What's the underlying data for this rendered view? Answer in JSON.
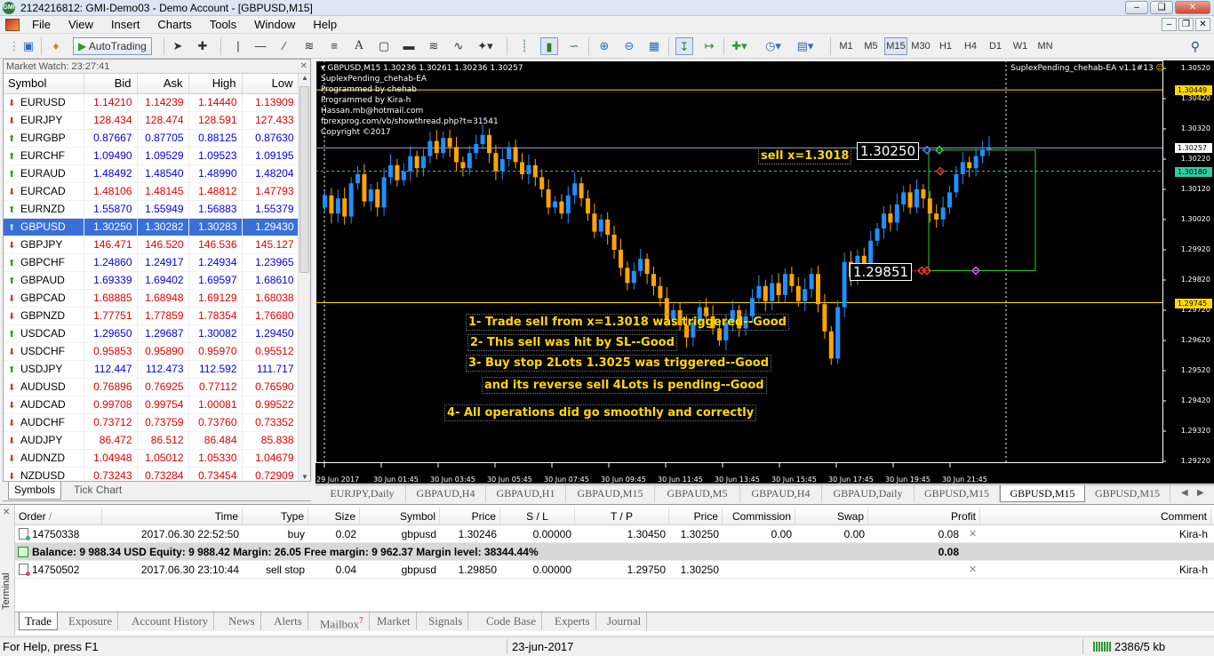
{
  "window": {
    "title": "2124216812: GMI-Demo03 - Demo Account - [GBPUSD,M15]",
    "app_icon_label": "GMI"
  },
  "menu": [
    "File",
    "View",
    "Insert",
    "Charts",
    "Tools",
    "Window",
    "Help"
  ],
  "toolbar": {
    "autotrading_label": "AutoTrading",
    "timeframes": [
      "M1",
      "M5",
      "M15",
      "M30",
      "H1",
      "H4",
      "D1",
      "W1",
      "MN"
    ],
    "active_timeframe": "M15"
  },
  "market_watch": {
    "title": "Market Watch: 23:27:41",
    "columns": [
      "Symbol",
      "Bid",
      "Ask",
      "High",
      "Low"
    ],
    "selected": "GBPUSD",
    "rows": [
      {
        "symbol": "EURUSD",
        "bid": "1.14210",
        "ask": "1.14239",
        "high": "1.14440",
        "low": "1.13909",
        "dir": "down"
      },
      {
        "symbol": "EURJPY",
        "bid": "128.434",
        "ask": "128.474",
        "high": "128.591",
        "low": "127.433",
        "dir": "down"
      },
      {
        "symbol": "EURGBP",
        "bid": "0.87667",
        "ask": "0.87705",
        "high": "0.88125",
        "low": "0.87630",
        "dir": "up"
      },
      {
        "symbol": "EURCHF",
        "bid": "1.09490",
        "ask": "1.09529",
        "high": "1.09523",
        "low": "1.09195",
        "dir": "up"
      },
      {
        "symbol": "EURAUD",
        "bid": "1.48492",
        "ask": "1.48540",
        "high": "1.48990",
        "low": "1.48204",
        "dir": "up"
      },
      {
        "symbol": "EURCAD",
        "bid": "1.48106",
        "ask": "1.48145",
        "high": "1.48812",
        "low": "1.47793",
        "dir": "down"
      },
      {
        "symbol": "EURNZD",
        "bid": "1.55870",
        "ask": "1.55949",
        "high": "1.56883",
        "low": "1.55379",
        "dir": "up"
      },
      {
        "symbol": "GBPUSD",
        "bid": "1.30250",
        "ask": "1.30282",
        "high": "1.30283",
        "low": "1.29430",
        "dir": "up"
      },
      {
        "symbol": "GBPJPY",
        "bid": "146.471",
        "ask": "146.520",
        "high": "146.536",
        "low": "145.127",
        "dir": "down"
      },
      {
        "symbol": "GBPCHF",
        "bid": "1.24860",
        "ask": "1.24917",
        "high": "1.24934",
        "low": "1.23965",
        "dir": "up"
      },
      {
        "symbol": "GBPAUD",
        "bid": "1.69339",
        "ask": "1.69402",
        "high": "1.69597",
        "low": "1.68610",
        "dir": "up"
      },
      {
        "symbol": "GBPCAD",
        "bid": "1.68885",
        "ask": "1.68948",
        "high": "1.69129",
        "low": "1.68038",
        "dir": "down"
      },
      {
        "symbol": "GBPNZD",
        "bid": "1.77751",
        "ask": "1.77859",
        "high": "1.78354",
        "low": "1.76680",
        "dir": "down"
      },
      {
        "symbol": "USDCAD",
        "bid": "1.29650",
        "ask": "1.29687",
        "high": "1.30082",
        "low": "1.29450",
        "dir": "up"
      },
      {
        "symbol": "USDCHF",
        "bid": "0.95853",
        "ask": "0.95890",
        "high": "0.95970",
        "low": "0.95512",
        "dir": "down"
      },
      {
        "symbol": "USDJPY",
        "bid": "112.447",
        "ask": "112.473",
        "high": "112.592",
        "low": "111.717",
        "dir": "up"
      },
      {
        "symbol": "AUDUSD",
        "bid": "0.76896",
        "ask": "0.76925",
        "high": "0.77112",
        "low": "0.76590",
        "dir": "down"
      },
      {
        "symbol": "AUDCAD",
        "bid": "0.99708",
        "ask": "0.99754",
        "high": "1.00081",
        "low": "0.99522",
        "dir": "down"
      },
      {
        "symbol": "AUDCHF",
        "bid": "0.73712",
        "ask": "0.73759",
        "high": "0.73760",
        "low": "0.73352",
        "dir": "down"
      },
      {
        "symbol": "AUDJPY",
        "bid": "86.472",
        "ask": "86.512",
        "high": "86.484",
        "low": "85.838",
        "dir": "down"
      },
      {
        "symbol": "AUDNZD",
        "bid": "1.04948",
        "ask": "1.05012",
        "high": "1.05330",
        "low": "1.04679",
        "dir": "down"
      },
      {
        "symbol": "NZDUSD",
        "bid": "0.73243",
        "ask": "0.73284",
        "high": "0.73454",
        "low": "0.72909",
        "dir": "down"
      }
    ],
    "tabs": [
      "Symbols",
      "Tick Chart"
    ],
    "active_tab": "Symbols"
  },
  "chart": {
    "header": "GBPUSD,M15  1.30236 1.30261 1.30236 1.30257",
    "ea_info": [
      "SuplexPending_chehab-EA",
      "Programmed by chehab",
      "Programmed by Kira-h",
      "Hassan.mb@hotmail.com",
      "forexprog.com/vb/showthread.php?t=31541",
      "Copyright ©2017"
    ],
    "ea_name": "SuplexPending_chehab-EA v1.1#13",
    "sell_label": "sell x=1.3018",
    "box_upper_label": "1.30250",
    "box_lower_label": "1.29851",
    "notes": [
      "1- Trade sell from x=1.3018 was triggered--Good",
      "2- This sell was hit by SL--Good",
      "3- Buy stop 2Lots 1.3025 was triggered--Good",
      "and its reverse sell 4Lots is pending--Good",
      "4- All operations did go smoothly and correctly"
    ],
    "price_labels": [
      "1.30520",
      "1.30420",
      "1.30320",
      "1.30220",
      "1.30120",
      "1.30020",
      "1.29920",
      "1.29820",
      "1.29720",
      "1.29620",
      "1.29520",
      "1.29420",
      "1.29320",
      "1.29220"
    ],
    "price_tags": [
      {
        "label": "1.30449",
        "color": "#ffd800",
        "text": "#000000"
      },
      {
        "label": "1.30257",
        "color": "#ffffff",
        "text": "#000000"
      },
      {
        "label": "1.30180",
        "color": "#2ccfa0",
        "text": "#000000"
      },
      {
        "label": "1.29745",
        "color": "#ffd800",
        "text": "#000000"
      }
    ],
    "time_labels": [
      "29 Jun 2017",
      "30 Jun 01:45",
      "30 Jun 03:45",
      "30 Jun 05:45",
      "30 Jun 07:45",
      "30 Jun 09:45",
      "30 Jun 11:45",
      "30 Jun 13:45",
      "30 Jun 15:45",
      "30 Jun 17:45",
      "30 Jun 19:45",
      "30 Jun 21:45"
    ],
    "bull_color": "#1e90ff",
    "bear_color": "#ffa500"
  },
  "chart_tabs": [
    "EURJPY,Daily",
    "GBPAUD,H4",
    "GBPAUD,H1",
    "GBPAUD,M15",
    "GBPAUD,M5",
    "GBPAUD,H4",
    "GBPAUD,Daily",
    "GBPUSD,M15",
    "GBPUSD,M15",
    "GBPUSD,M15"
  ],
  "active_chart_tab": 8,
  "terminal": {
    "side_label": "Terminal",
    "columns": [
      "Order",
      "Time",
      "Type",
      "Size",
      "Symbol",
      "Price",
      "S / L",
      "T / P",
      "Price",
      "Commission",
      "Swap",
      "Profit",
      "Comment"
    ],
    "sort_indicator": "/",
    "orders": [
      {
        "order": "14750338",
        "time": "2017.06.30 22:52:50",
        "type": "buy",
        "size": "0.02",
        "symbol": "gbpusd",
        "price": "1.30246",
        "sl": "0.00000",
        "tp": "1.30450",
        "cur_price": "1.30250",
        "commission": "0.00",
        "swap": "0.00",
        "profit": "0.08",
        "comment": "Kira-h",
        "pending": false
      }
    ],
    "balance_line": "Balance: 9 988.34 USD  Equity: 9 988.42  Margin: 26.05  Free margin: 9 962.37  Margin level: 38344.44%",
    "balance_profit": "0.08",
    "pending": [
      {
        "order": "14750502",
        "time": "2017.06.30 23:10:44",
        "type": "sell stop",
        "size": "0.04",
        "symbol": "gbpusd",
        "price": "1.29850",
        "sl": "0.00000",
        "tp": "1.29750",
        "cur_price": "1.30250",
        "comment": "Kira-h",
        "pending": true
      }
    ],
    "tabs": [
      "Trade",
      "Exposure",
      "Account History",
      "News",
      "Alerts",
      "Mailbox",
      "Market",
      "Signals",
      "Code Base",
      "Experts",
      "Journal"
    ],
    "mailbox_badge": "7",
    "active_tab": "Trade"
  },
  "status": {
    "help": "For Help, press F1",
    "date": "23-jun-2017",
    "traffic": "2386/5 kb"
  }
}
